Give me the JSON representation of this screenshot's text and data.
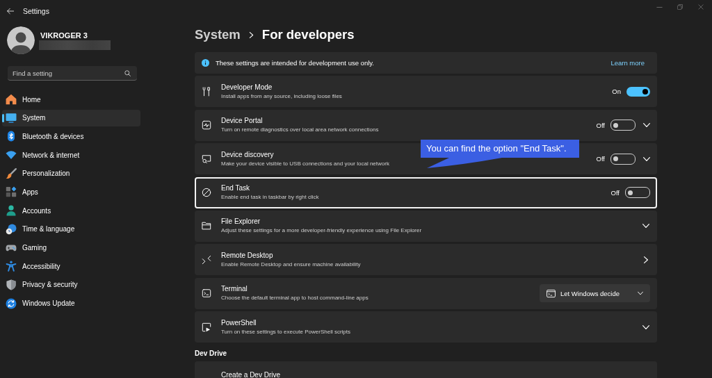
{
  "window": {
    "title": "Settings"
  },
  "account": {
    "name": "VIKROGER 3"
  },
  "search": {
    "placeholder": "Find a setting"
  },
  "sidebar": {
    "items": [
      {
        "label": "Home",
        "selected": false
      },
      {
        "label": "System",
        "selected": true
      },
      {
        "label": "Bluetooth & devices",
        "selected": false
      },
      {
        "label": "Network & internet",
        "selected": false
      },
      {
        "label": "Personalization",
        "selected": false
      },
      {
        "label": "Apps",
        "selected": false
      },
      {
        "label": "Accounts",
        "selected": false
      },
      {
        "label": "Time & language",
        "selected": false
      },
      {
        "label": "Gaming",
        "selected": false
      },
      {
        "label": "Accessibility",
        "selected": false
      },
      {
        "label": "Privacy & security",
        "selected": false
      },
      {
        "label": "Windows Update",
        "selected": false
      }
    ]
  },
  "breadcrumb": {
    "parent": "System",
    "current": "For developers"
  },
  "info_banner": {
    "text": "These settings are intended for development use only.",
    "link": "Learn more"
  },
  "settings": [
    {
      "kind": "toggle",
      "title": "Developer Mode",
      "description": "Install apps from any source, including loose files",
      "state_label": "On",
      "on": true,
      "expandable": false,
      "highlighted": false
    },
    {
      "kind": "toggle",
      "title": "Device Portal",
      "description": "Turn on remote diagnostics over local area network connections",
      "state_label": "Off",
      "on": false,
      "expandable": true,
      "highlighted": false
    },
    {
      "kind": "toggle",
      "title": "Device discovery",
      "description": "Make your device visible to USB connections and your local network",
      "state_label": "Off",
      "on": false,
      "expandable": true,
      "highlighted": false,
      "callout": "You can find the option \"End Task\"."
    },
    {
      "kind": "toggle",
      "title": "End Task",
      "description": "Enable end task in taskbar by right click",
      "state_label": "Off",
      "on": false,
      "expandable": false,
      "highlighted": true
    },
    {
      "kind": "expander",
      "title": "File Explorer",
      "description": "Adjust these settings for a more developer-friendly experience using File Explorer",
      "highlighted": false
    },
    {
      "kind": "link",
      "title": "Remote Desktop",
      "description": "Enable Remote Desktop and ensure machine availability",
      "highlighted": false
    },
    {
      "kind": "dropdown",
      "title": "Terminal",
      "description": "Choose the default terminal app to host command-line apps",
      "value": "Let Windows decide",
      "highlighted": false
    },
    {
      "kind": "expander",
      "title": "PowerShell",
      "description": "Turn on these settings to execute PowerShell scripts",
      "highlighted": false
    }
  ],
  "dev_drive": {
    "heading": "Dev Drive",
    "items": [
      {
        "title": "Create a Dev Drive"
      }
    ]
  }
}
